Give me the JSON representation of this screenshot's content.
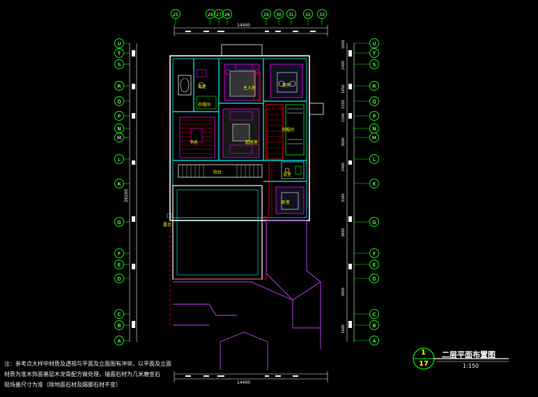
{
  "grid": {
    "top_axes": [
      "25",
      "26",
      "27",
      "28",
      "29",
      "30",
      "31",
      "32",
      "33"
    ],
    "row_axes": [
      "U",
      "T",
      "S",
      "R",
      "Q",
      "P",
      "N",
      "M",
      "L",
      "K",
      "G",
      "F",
      "E",
      "D",
      "C",
      "B",
      "A"
    ],
    "top_dimension": "14400",
    "bottom_dimension": "14400",
    "left_dimension": "28200",
    "right_dimensions": [
      "1600",
      "2400",
      "1650",
      "1550",
      "1200",
      "3600",
      "2400",
      "3300",
      "3800",
      "3900",
      "1600"
    ]
  },
  "rooms": {
    "master_bedroom": "主人房",
    "bathroom": "浴室",
    "cloakroom": "衣帽间",
    "study": "书房",
    "bedroom": "卧室",
    "balcony": "阳台",
    "bathroom2": "浴室",
    "guest_room": "客房",
    "terrace": "露台",
    "lounge": "起居室"
  },
  "notes": [
    "注：参考点大样中材质及透视与平面及立面图有冲突，以平面及立面",
    "材质为准木饰面基层木龙骨配方做处理，墙面石材为几米磨金石",
    "现场量尺寸为准（除地面石材及踢脚石材不变）"
  ],
  "title_block": {
    "number": "1",
    "sheet": "17",
    "title": "二层平面布置图",
    "scale": "1:150"
  },
  "colors": {
    "axis_bubble": "#00ff00",
    "walls": "#ffffff",
    "structure": "#00ffff",
    "furniture": "#ff00ff",
    "hatch_red": "#ff0000",
    "room_label": "#ffff00",
    "background": "#000000"
  }
}
